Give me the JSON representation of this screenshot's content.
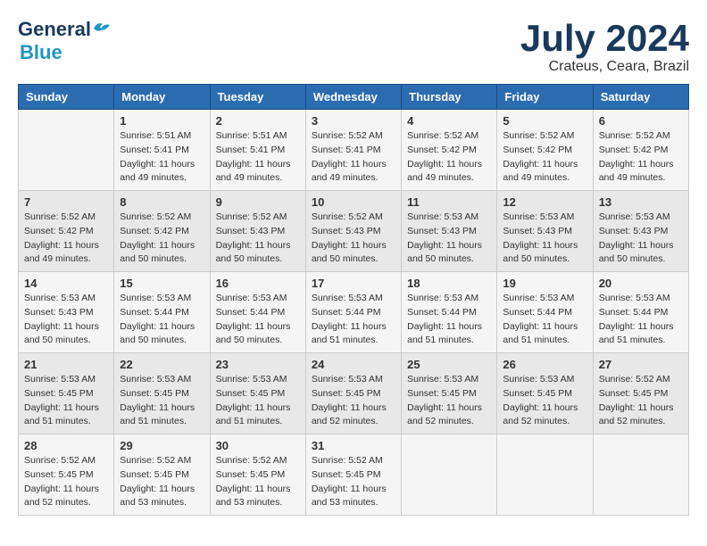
{
  "header": {
    "logo_general": "General",
    "logo_blue": "Blue",
    "month_title": "July 2024",
    "location": "Crateus, Ceara, Brazil"
  },
  "weekdays": [
    "Sunday",
    "Monday",
    "Tuesday",
    "Wednesday",
    "Thursday",
    "Friday",
    "Saturday"
  ],
  "rows": [
    [
      {
        "day": "",
        "sunrise": "",
        "sunset": "",
        "daylight": ""
      },
      {
        "day": "1",
        "sunrise": "Sunrise: 5:51 AM",
        "sunset": "Sunset: 5:41 PM",
        "daylight": "Daylight: 11 hours and 49 minutes."
      },
      {
        "day": "2",
        "sunrise": "Sunrise: 5:51 AM",
        "sunset": "Sunset: 5:41 PM",
        "daylight": "Daylight: 11 hours and 49 minutes."
      },
      {
        "day": "3",
        "sunrise": "Sunrise: 5:52 AM",
        "sunset": "Sunset: 5:41 PM",
        "daylight": "Daylight: 11 hours and 49 minutes."
      },
      {
        "day": "4",
        "sunrise": "Sunrise: 5:52 AM",
        "sunset": "Sunset: 5:42 PM",
        "daylight": "Daylight: 11 hours and 49 minutes."
      },
      {
        "day": "5",
        "sunrise": "Sunrise: 5:52 AM",
        "sunset": "Sunset: 5:42 PM",
        "daylight": "Daylight: 11 hours and 49 minutes."
      },
      {
        "day": "6",
        "sunrise": "Sunrise: 5:52 AM",
        "sunset": "Sunset: 5:42 PM",
        "daylight": "Daylight: 11 hours and 49 minutes."
      }
    ],
    [
      {
        "day": "7",
        "sunrise": "Sunrise: 5:52 AM",
        "sunset": "Sunset: 5:42 PM",
        "daylight": "Daylight: 11 hours and 49 minutes."
      },
      {
        "day": "8",
        "sunrise": "Sunrise: 5:52 AM",
        "sunset": "Sunset: 5:42 PM",
        "daylight": "Daylight: 11 hours and 50 minutes."
      },
      {
        "day": "9",
        "sunrise": "Sunrise: 5:52 AM",
        "sunset": "Sunset: 5:43 PM",
        "daylight": "Daylight: 11 hours and 50 minutes."
      },
      {
        "day": "10",
        "sunrise": "Sunrise: 5:52 AM",
        "sunset": "Sunset: 5:43 PM",
        "daylight": "Daylight: 11 hours and 50 minutes."
      },
      {
        "day": "11",
        "sunrise": "Sunrise: 5:53 AM",
        "sunset": "Sunset: 5:43 PM",
        "daylight": "Daylight: 11 hours and 50 minutes."
      },
      {
        "day": "12",
        "sunrise": "Sunrise: 5:53 AM",
        "sunset": "Sunset: 5:43 PM",
        "daylight": "Daylight: 11 hours and 50 minutes."
      },
      {
        "day": "13",
        "sunrise": "Sunrise: 5:53 AM",
        "sunset": "Sunset: 5:43 PM",
        "daylight": "Daylight: 11 hours and 50 minutes."
      }
    ],
    [
      {
        "day": "14",
        "sunrise": "Sunrise: 5:53 AM",
        "sunset": "Sunset: 5:43 PM",
        "daylight": "Daylight: 11 hours and 50 minutes."
      },
      {
        "day": "15",
        "sunrise": "Sunrise: 5:53 AM",
        "sunset": "Sunset: 5:44 PM",
        "daylight": "Daylight: 11 hours and 50 minutes."
      },
      {
        "day": "16",
        "sunrise": "Sunrise: 5:53 AM",
        "sunset": "Sunset: 5:44 PM",
        "daylight": "Daylight: 11 hours and 50 minutes."
      },
      {
        "day": "17",
        "sunrise": "Sunrise: 5:53 AM",
        "sunset": "Sunset: 5:44 PM",
        "daylight": "Daylight: 11 hours and 51 minutes."
      },
      {
        "day": "18",
        "sunrise": "Sunrise: 5:53 AM",
        "sunset": "Sunset: 5:44 PM",
        "daylight": "Daylight: 11 hours and 51 minutes."
      },
      {
        "day": "19",
        "sunrise": "Sunrise: 5:53 AM",
        "sunset": "Sunset: 5:44 PM",
        "daylight": "Daylight: 11 hours and 51 minutes."
      },
      {
        "day": "20",
        "sunrise": "Sunrise: 5:53 AM",
        "sunset": "Sunset: 5:44 PM",
        "daylight": "Daylight: 11 hours and 51 minutes."
      }
    ],
    [
      {
        "day": "21",
        "sunrise": "Sunrise: 5:53 AM",
        "sunset": "Sunset: 5:45 PM",
        "daylight": "Daylight: 11 hours and 51 minutes."
      },
      {
        "day": "22",
        "sunrise": "Sunrise: 5:53 AM",
        "sunset": "Sunset: 5:45 PM",
        "daylight": "Daylight: 11 hours and 51 minutes."
      },
      {
        "day": "23",
        "sunrise": "Sunrise: 5:53 AM",
        "sunset": "Sunset: 5:45 PM",
        "daylight": "Daylight: 11 hours and 51 minutes."
      },
      {
        "day": "24",
        "sunrise": "Sunrise: 5:53 AM",
        "sunset": "Sunset: 5:45 PM",
        "daylight": "Daylight: 11 hours and 52 minutes."
      },
      {
        "day": "25",
        "sunrise": "Sunrise: 5:53 AM",
        "sunset": "Sunset: 5:45 PM",
        "daylight": "Daylight: 11 hours and 52 minutes."
      },
      {
        "day": "26",
        "sunrise": "Sunrise: 5:53 AM",
        "sunset": "Sunset: 5:45 PM",
        "daylight": "Daylight: 11 hours and 52 minutes."
      },
      {
        "day": "27",
        "sunrise": "Sunrise: 5:52 AM",
        "sunset": "Sunset: 5:45 PM",
        "daylight": "Daylight: 11 hours and 52 minutes."
      }
    ],
    [
      {
        "day": "28",
        "sunrise": "Sunrise: 5:52 AM",
        "sunset": "Sunset: 5:45 PM",
        "daylight": "Daylight: 11 hours and 52 minutes."
      },
      {
        "day": "29",
        "sunrise": "Sunrise: 5:52 AM",
        "sunset": "Sunset: 5:45 PM",
        "daylight": "Daylight: 11 hours and 53 minutes."
      },
      {
        "day": "30",
        "sunrise": "Sunrise: 5:52 AM",
        "sunset": "Sunset: 5:45 PM",
        "daylight": "Daylight: 11 hours and 53 minutes."
      },
      {
        "day": "31",
        "sunrise": "Sunrise: 5:52 AM",
        "sunset": "Sunset: 5:45 PM",
        "daylight": "Daylight: 11 hours and 53 minutes."
      },
      {
        "day": "",
        "sunrise": "",
        "sunset": "",
        "daylight": ""
      },
      {
        "day": "",
        "sunrise": "",
        "sunset": "",
        "daylight": ""
      },
      {
        "day": "",
        "sunrise": "",
        "sunset": "",
        "daylight": ""
      }
    ]
  ]
}
